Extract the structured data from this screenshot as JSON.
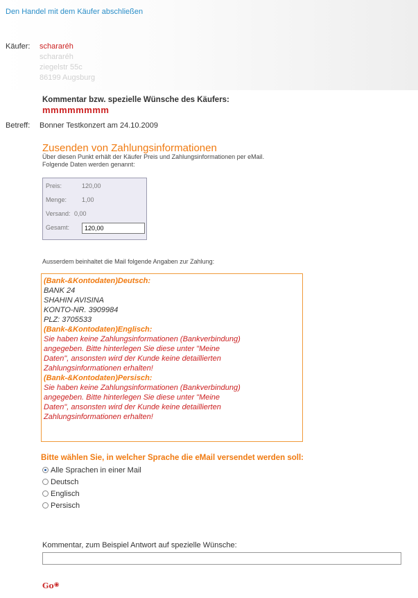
{
  "header": {
    "link_text": "Den Handel mit dem Käufer abschließen"
  },
  "buyer": {
    "label": "Käufer:",
    "name": "schararéh",
    "address_lines": [
      "schararéh",
      "ziegelstr 55c",
      "86199 Augsburg"
    ]
  },
  "comment": {
    "title": "Kommentar bzw. spezielle Wünsche des Käufers:",
    "value": "mmmmmmmm"
  },
  "subject": {
    "label": "Betreff:",
    "value": "Bonner Testkonzert am 24.10.2009"
  },
  "payment": {
    "title": "Zusenden von Zahlungsinformationen",
    "desc_line1": "Über diesen Punkt erhält der Käufer Preis und Zahlungsinformationen per eMail.",
    "desc_line2": "Folgende Daten werden genannt:",
    "price_label": "Preis:",
    "price_value": "120,00",
    "qty_label": "Menge:",
    "qty_value": "1,00",
    "ship_label": "Versand:",
    "ship_value": "0,00",
    "total_label": "Gesamt:",
    "total_value": "120,00"
  },
  "mail_info": {
    "intro": "Ausserdem beinhaltet die Mail folgende Angaben zur Zahlung:"
  },
  "bank": {
    "de_header": "(Bank-&Kontodaten)Deutsch:",
    "de_lines": [
      "BANK 24",
      "SHAHIN AVISINA",
      "KONTO-NR. 3909984",
      "PLZ: 3705533"
    ],
    "en_header": "(Bank-&Kontodaten)Englisch:",
    "en_lines": [
      "Sie haben keine Zahlungsinformationen (Bankverbindung)",
      "angegeben. Bitte hinterlegen Sie diese unter \"Meine",
      "Daten\", ansonsten wird der Kunde keine detaillierten",
      "Zahlungsinformationen erhalten!"
    ],
    "fa_header": "(Bank-&Kontodaten)Persisch:",
    "fa_lines": [
      "Sie haben keine Zahlungsinformationen (Bankverbindung)",
      "angegeben. Bitte hinterlegen Sie diese unter \"Meine",
      "Daten\", ansonsten wird der Kunde keine detaillierten",
      "Zahlungsinformationen erhalten!"
    ]
  },
  "language": {
    "question": "Bitte wählen Sie, in welcher Sprache die eMail versendet werden soll:",
    "options": [
      "Alle Sprachen in einer Mail",
      "Deutsch",
      "Englisch",
      "Persisch"
    ],
    "selected": "Alle Sprachen in einer Mail"
  },
  "reply": {
    "label": "Kommentar, zum Beispiel Antwort auf spezielle Wünsche:",
    "value": ""
  },
  "submit": {
    "label": "Go"
  }
}
